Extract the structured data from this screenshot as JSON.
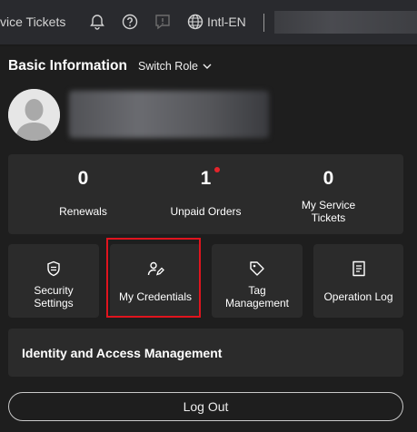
{
  "topbar": {
    "service_tickets": "vice Tickets",
    "language": "Intl-EN",
    "icons": [
      "bell-icon",
      "help-icon",
      "feedback-icon",
      "globe-icon"
    ]
  },
  "header": {
    "title": "Basic Information",
    "switch_role": "Switch Role"
  },
  "stats": [
    {
      "value": "0",
      "label": "Renewals"
    },
    {
      "value": "1",
      "label": "Unpaid Orders",
      "has_badge": true
    },
    {
      "value": "0",
      "label": "My Service Tickets"
    }
  ],
  "tiles": [
    {
      "label": "Security Settings",
      "icon": "shield-icon"
    },
    {
      "label": "My Credentials",
      "icon": "credentials-icon",
      "highlighted": true
    },
    {
      "label": "Tag Management",
      "icon": "tag-icon"
    },
    {
      "label": "Operation Log",
      "icon": "document-icon"
    }
  ],
  "iam": {
    "label": "Identity and Access Management"
  },
  "logout": {
    "label": "Log Out"
  },
  "colors": {
    "background": "#1e1e1e",
    "card": "#2b2b2b",
    "topbar": "#292a2e",
    "highlight": "#e0141e",
    "badge": "#e5242b"
  }
}
